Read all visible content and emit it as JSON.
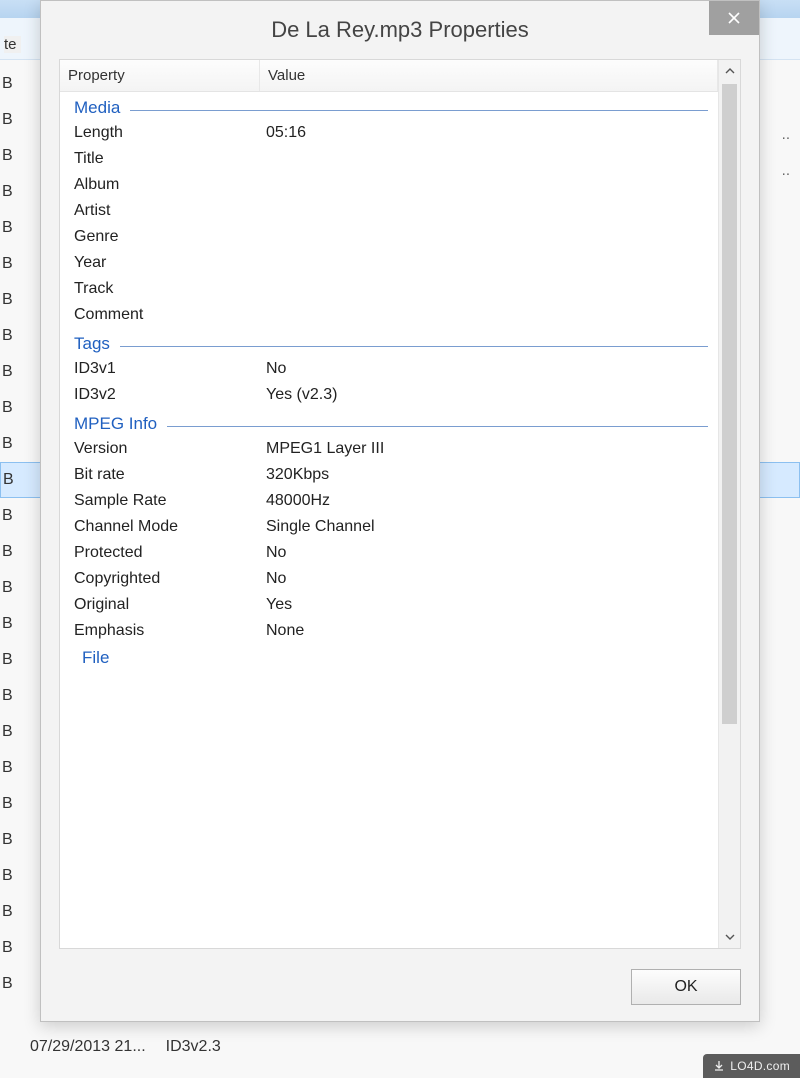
{
  "bg": {
    "rows": [
      "B",
      "B",
      "B",
      "B",
      "B",
      "B",
      "B",
      "B",
      "B",
      "B",
      "B",
      "B",
      "B",
      "B",
      "B",
      "B",
      "B",
      "B",
      "B",
      "B",
      "B",
      "B",
      "B",
      "B",
      "B",
      "B"
    ],
    "selected_index": 11,
    "col_header_fragment": "te",
    "ellipsis1": "..",
    "ellipsis2": "..",
    "bottom_date": "07/29/2013 21...",
    "bottom_tag": "ID3v2.3"
  },
  "dialog": {
    "title": "De La Rey.mp3 Properties",
    "columns": {
      "property": "Property",
      "value": "Value"
    },
    "sections": [
      {
        "name": "Media",
        "rows": [
          {
            "p": "Length",
            "v": "05:16"
          },
          {
            "p": "Title",
            "v": ""
          },
          {
            "p": "Album",
            "v": ""
          },
          {
            "p": "Artist",
            "v": ""
          },
          {
            "p": "Genre",
            "v": ""
          },
          {
            "p": "Year",
            "v": ""
          },
          {
            "p": "Track",
            "v": ""
          },
          {
            "p": "Comment",
            "v": ""
          }
        ]
      },
      {
        "name": "Tags",
        "rows": [
          {
            "p": "ID3v1",
            "v": "No"
          },
          {
            "p": "ID3v2",
            "v": "Yes (v2.3)"
          }
        ]
      },
      {
        "name": "MPEG Info",
        "rows": [
          {
            "p": "Version",
            "v": "MPEG1 Layer III"
          },
          {
            "p": "Bit rate",
            "v": "320Kbps"
          },
          {
            "p": "Sample Rate",
            "v": "48000Hz"
          },
          {
            "p": "Channel Mode",
            "v": "Single Channel"
          },
          {
            "p": "Protected",
            "v": "No"
          },
          {
            "p": "Copyrighted",
            "v": "No"
          },
          {
            "p": "Original",
            "v": "Yes"
          },
          {
            "p": "Emphasis",
            "v": "None"
          }
        ]
      }
    ],
    "partial_section": "File",
    "ok_label": "OK"
  },
  "watermark": "LO4D.com"
}
